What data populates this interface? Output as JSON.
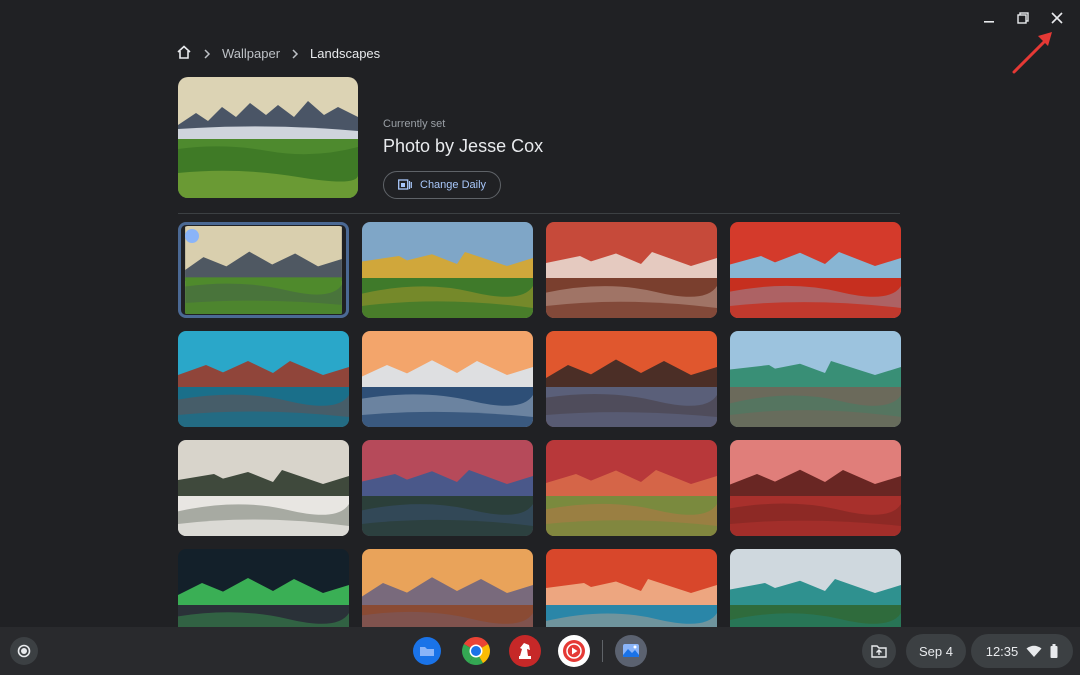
{
  "window": {
    "controls": [
      "minimize",
      "restore",
      "close"
    ]
  },
  "breadcrumb": {
    "items": [
      "Wallpaper",
      "Landscapes"
    ]
  },
  "current": {
    "label": "Currently set",
    "title": "Photo by Jesse Cox",
    "change_daily_label": "Change Daily"
  },
  "wallpapers": [
    {
      "name": "mountain range meadow",
      "selected": true,
      "sky": "#d9cfae",
      "ground": "#4f8a2c",
      "accent": "#3f4a5a"
    },
    {
      "name": "poppy field hills",
      "selected": false,
      "sky": "#7fa6c7",
      "ground": "#3f7a2a",
      "accent": "#d9a72b"
    },
    {
      "name": "red mountains",
      "selected": false,
      "sky": "#c64a3a",
      "ground": "#7a3f2e",
      "accent": "#e8d8cf"
    },
    {
      "name": "red river aerial",
      "selected": false,
      "sky": "#d43a2b",
      "ground": "#c62f1f",
      "accent": "#7fc3e6"
    },
    {
      "name": "ice cave",
      "selected": false,
      "sky": "#2aa7c9",
      "ground": "#1a6f8a",
      "accent": "#9b3b2a"
    },
    {
      "name": "volcano sea of clouds",
      "selected": false,
      "sky": "#f3a56b",
      "ground": "#2e4f77",
      "accent": "#dce6ee"
    },
    {
      "name": "sea stacks sunset",
      "selected": false,
      "sky": "#e0572e",
      "ground": "#5a5f79",
      "accent": "#3b2a26"
    },
    {
      "name": "mountain lake rocks",
      "selected": false,
      "sky": "#9cc3de",
      "ground": "#6b6a5b",
      "accent": "#2f8a6a"
    },
    {
      "name": "snowy forest peaks",
      "selected": false,
      "sky": "#d8d4cb",
      "ground": "#e8e6e2",
      "accent": "#2f3a2c"
    },
    {
      "name": "volcano forest lake",
      "selected": false,
      "sky": "#b64a5a",
      "ground": "#2b3f3a",
      "accent": "#3e5a8f"
    },
    {
      "name": "red volcano meadow",
      "selected": false,
      "sky": "#b8383a",
      "ground": "#7a8a3e",
      "accent": "#d86a4a"
    },
    {
      "name": "red canyon",
      "selected": false,
      "sky": "#e07e7a",
      "ground": "#a8302c",
      "accent": "#5c1d1a"
    },
    {
      "name": "aurora night",
      "selected": false,
      "sky": "#13202a",
      "ground": "#2a3138",
      "accent": "#3fbf5a"
    },
    {
      "name": "grand canyon sunset",
      "selected": false,
      "sky": "#e9a35a",
      "ground": "#8a4b34",
      "accent": "#6d6480"
    },
    {
      "name": "abstract aerial",
      "selected": false,
      "sky": "#d8472b",
      "ground": "#2a86a8",
      "accent": "#f0b08a"
    },
    {
      "name": "alpine lake forest",
      "selected": false,
      "sky": "#cfd8de",
      "ground": "#2f6b3c",
      "accent": "#1d8a86"
    }
  ],
  "shelf": {
    "apps": [
      "files-app",
      "chrome-app",
      "lichess-app",
      "youtube-music-app",
      "wallpaper-app"
    ],
    "date": "Sep 4",
    "time": "12:35"
  },
  "colors": {
    "background": "#202124",
    "accent": "#a8c7fa",
    "annotation_arrow": "#e53935"
  }
}
